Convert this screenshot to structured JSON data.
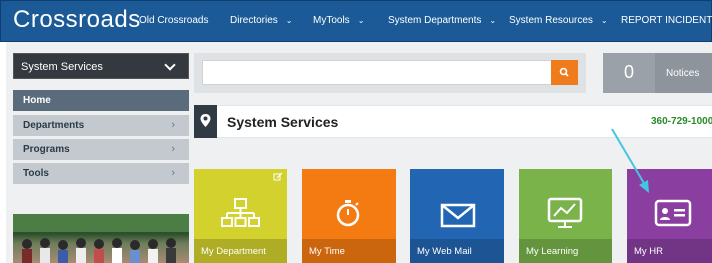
{
  "header": {
    "brand": "Crossroads",
    "nav": [
      {
        "label": "Old Crossroads",
        "has_menu": false
      },
      {
        "label": "Directories",
        "has_menu": true
      },
      {
        "label": "MyTools",
        "has_menu": true
      },
      {
        "label": "System Departments",
        "has_menu": true
      },
      {
        "label": "System Resources",
        "has_menu": true
      },
      {
        "label": "REPORT INCIDENT",
        "has_menu": true
      }
    ]
  },
  "sidebar": {
    "selected_unit": "System Services",
    "items": [
      {
        "label": "Home",
        "active": true
      },
      {
        "label": "Departments",
        "active": false
      },
      {
        "label": "Programs",
        "active": false
      },
      {
        "label": "Tools",
        "active": false
      }
    ]
  },
  "search": {
    "value": "",
    "icon": "search-icon"
  },
  "notices": {
    "count": "0",
    "label": "Notices"
  },
  "section": {
    "title": "System Services",
    "phone": "360-729-1000"
  },
  "tiles": [
    {
      "label": "My Department",
      "color": "#d3d12d",
      "icon": "org-chart-icon"
    },
    {
      "label": "My Time",
      "color": "#f47b12",
      "icon": "stopwatch-icon"
    },
    {
      "label": "My Web Mail",
      "color": "#2266b3",
      "icon": "envelope-icon"
    },
    {
      "label": "My Learning",
      "color": "#79b34a",
      "icon": "presentation-board-icon"
    },
    {
      "label": "My HR",
      "color": "#8a3fa0",
      "icon": "id-card-icon"
    }
  ],
  "colors": {
    "header": "#1b5a96",
    "accent_orange": "#f07b1d",
    "annotation_arrow": "#45c6e0"
  }
}
